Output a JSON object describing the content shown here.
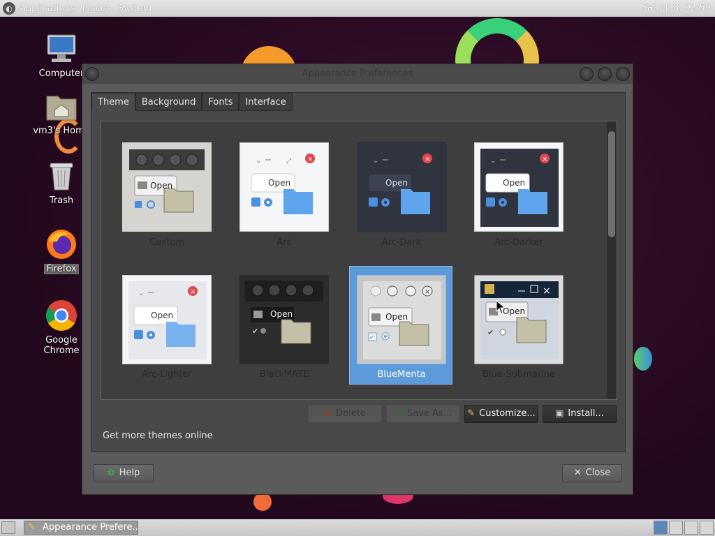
{
  "top_panel": {
    "menus": [
      "Applications",
      "Places",
      "System"
    ],
    "clock": "Sat Jul 8, 02:59"
  },
  "desktop_icons": [
    {
      "label": "Computer"
    },
    {
      "label": "vm3's Home"
    },
    {
      "label": "Trash"
    },
    {
      "label": "Firefox"
    },
    {
      "label": "Google Chrome"
    }
  ],
  "window": {
    "title": "Appearance Preferences",
    "tabs": [
      "Theme",
      "Background",
      "Fonts",
      "Interface"
    ],
    "active_tab": "Theme",
    "themes": [
      {
        "name": "Custom",
        "sample": "Open"
      },
      {
        "name": "Arc",
        "sample": "Open"
      },
      {
        "name": "Arc-Dark",
        "sample": "Open"
      },
      {
        "name": "Arc-Darker",
        "sample": "Open"
      },
      {
        "name": "Arc-Lighter",
        "sample": "Open"
      },
      {
        "name": "BlackMATE",
        "sample": "Open"
      },
      {
        "name": "BlueMenta",
        "sample": "Open",
        "selected": true
      },
      {
        "name": "Blue-Submarine",
        "sample": "Open"
      }
    ],
    "buttons": {
      "delete": "Delete",
      "save_as": "Save As...",
      "customize": "Customize...",
      "install": "Install..."
    },
    "more_online": "Get more themes online",
    "help": "Help",
    "close": "Close"
  },
  "taskbar": {
    "item": "Appearance Prefere..."
  },
  "colors": {
    "selection": "#5c9ad9",
    "accent_blue": "#4a90e2",
    "close_red": "#e0474c"
  }
}
